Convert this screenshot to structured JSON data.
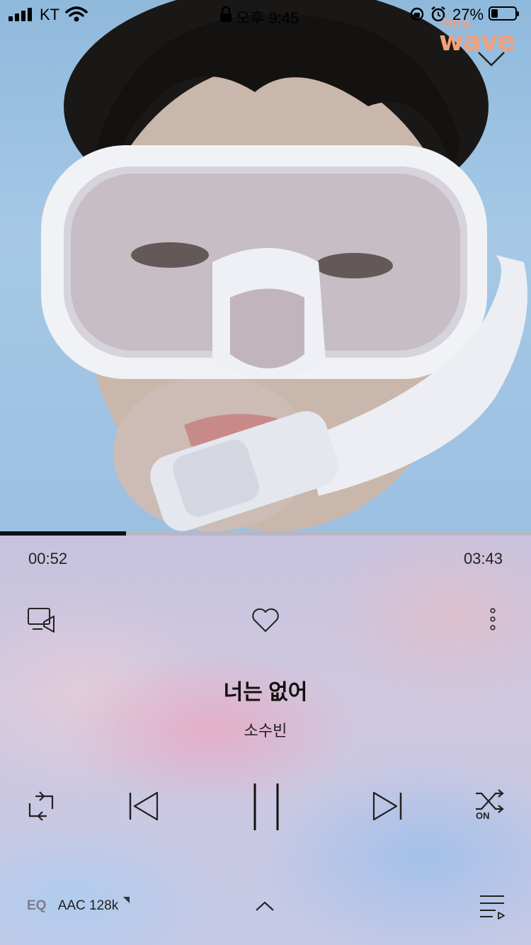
{
  "status_bar": {
    "carrier": "KT",
    "time": "오후 9:45",
    "battery_percent": "27%",
    "battery_level": 0.27
  },
  "album_art": {
    "logo_hey": "Hey,",
    "logo_wave": "wave"
  },
  "player": {
    "progress_fraction": 0.237,
    "current_time": "00:52",
    "total_time": "03:43",
    "song_title": "너는 없어",
    "artist": "소수빈",
    "eq_label": "EQ",
    "codec_label": "AAC 128k",
    "shuffle_state": "ON"
  },
  "icons": {
    "collapse": "chevron-down-icon",
    "cast": "cast-screen-icon",
    "like": "heart-icon",
    "more": "more-vertical-icon",
    "repeat": "repeat-icon",
    "previous": "skip-previous-icon",
    "pause": "pause-icon",
    "next": "skip-next-icon",
    "shuffle": "shuffle-icon",
    "expand": "chevron-up-icon",
    "playlist": "playlist-icon"
  }
}
